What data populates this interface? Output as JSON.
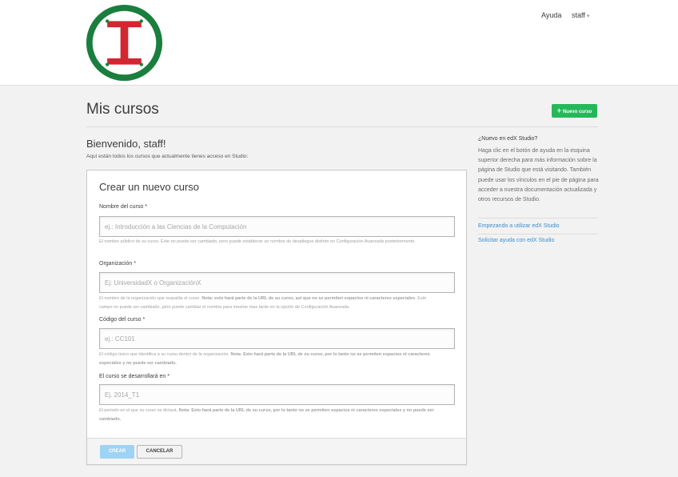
{
  "brand": {
    "logo_name": "institution-logo",
    "ring_color": "#1a7e3e",
    "letter_color": "#d22630"
  },
  "nav": {
    "help_label": "Ayuda",
    "user_label": "staff"
  },
  "page": {
    "title": "Mis cursos",
    "new_course_label": "Nuevo curso",
    "welcome_title": "Bienvenido, staff!",
    "welcome_sub": "Aquí están todos los cursos que actualmente tienes acceso en Studio:"
  },
  "form": {
    "title": "Crear un nuevo curso",
    "fields": [
      {
        "label": "Nombre del curso",
        "required_mark": "*",
        "placeholder": "ej.: Introducción a las Ciencias de la Computación",
        "value": "",
        "help": "El nombre público de su curso. Este no puede ser cambiado, pero puede establecer un nombre de despliegue distinto en Configuración Avanzada posteriormente.",
        "help_bold": ""
      },
      {
        "label": "Organización",
        "required_mark": "*",
        "placeholder": "Ej: UniversidadX o OrganizaciónX",
        "value": "",
        "help": "El nombre de la organización que respalda el curso. ",
        "help_bold": "Nota: esto hará parte de la URL de su curso, así que no se permiten espacios ni caracteres especiales",
        "help_after": ". Este campo no puede ser cambiado, pero puede cambiar el nombre para mostrar mas tarde en la opción de Configuración Avanzada."
      },
      {
        "label": "Código del curso",
        "required_mark": "*",
        "placeholder": "ej.: CC101",
        "value": "",
        "help": "El código único que identifica a su curso dentro de la organización. ",
        "help_bold": "Nota: Esto hará parte de la URL de su curso, por lo tanto no se permiten espacios ni caracteres especiales y no puede ser cambiado.",
        "help_after": ""
      },
      {
        "label": "El curso se desarrollará en",
        "required_mark": "*",
        "placeholder": "Ej. 2014_T1",
        "value": "",
        "help": "El periodo en el que su curso se dictará. ",
        "help_bold": "Nota: Esto hará parte de la URL de su curso, por lo tanto no se permiten espacios ni caracteres especiales y no puede ser cambiado.",
        "help_after": ""
      }
    ],
    "create_label": "CREAR",
    "cancel_label": "CANCELAR"
  },
  "sidebar": {
    "title": "¿Nuevo en edX Studio?",
    "text": "Haga clic en el botón de ayuda en la esquina superior derecha para más información sobre la página de Studio que está visitando. También puede usar los vínculos en el pie de página para acceder a nuestra documentación actualizada y otros recursos de Studio.",
    "links": [
      "Empezando a utilizar edX Studio",
      "Solicitar ayuda con edX Studio"
    ]
  },
  "colors": {
    "accent_green": "#25b85a",
    "link_blue": "#3c8dd0",
    "create_button": "#9ed3f4"
  }
}
